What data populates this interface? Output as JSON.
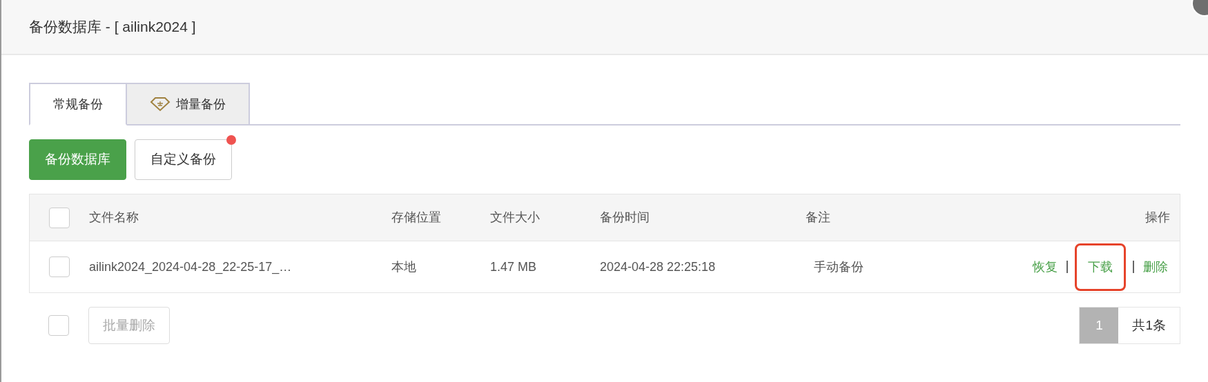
{
  "window": {
    "title": "备份数据库 - [ ailink2024 ]"
  },
  "tabs": [
    {
      "label": "常规备份",
      "selected": true,
      "icon": false
    },
    {
      "label": "增量备份",
      "selected": false,
      "icon": true
    }
  ],
  "toolbar": [
    {
      "label": "备份数据库",
      "kind": "primary",
      "badge": false
    },
    {
      "label": "自定义备份",
      "kind": "default",
      "badge": true
    }
  ],
  "table": {
    "header_checked": false,
    "columns": [
      "文件名称",
      "存储位置",
      "文件大小",
      "备份时间",
      "备注",
      "操作"
    ],
    "rows": [
      {
        "checked": false,
        "cells": [
          "ailink2024_2024-04-28_22-25-17_…",
          "本地",
          "1.47 MB",
          "2024-04-28 22:25:18",
          "手动备份"
        ],
        "actions": [
          {
            "label": "恢复",
            "highlighted": false
          },
          {
            "label": "下载",
            "highlighted": true
          },
          {
            "label": "删除",
            "highlighted": false
          }
        ]
      }
    ]
  },
  "footer": {
    "select_all_checked": false,
    "bulk_delete": "批量删除",
    "pages": [
      {
        "label": "1",
        "selected": true
      }
    ],
    "total": "共1条"
  }
}
